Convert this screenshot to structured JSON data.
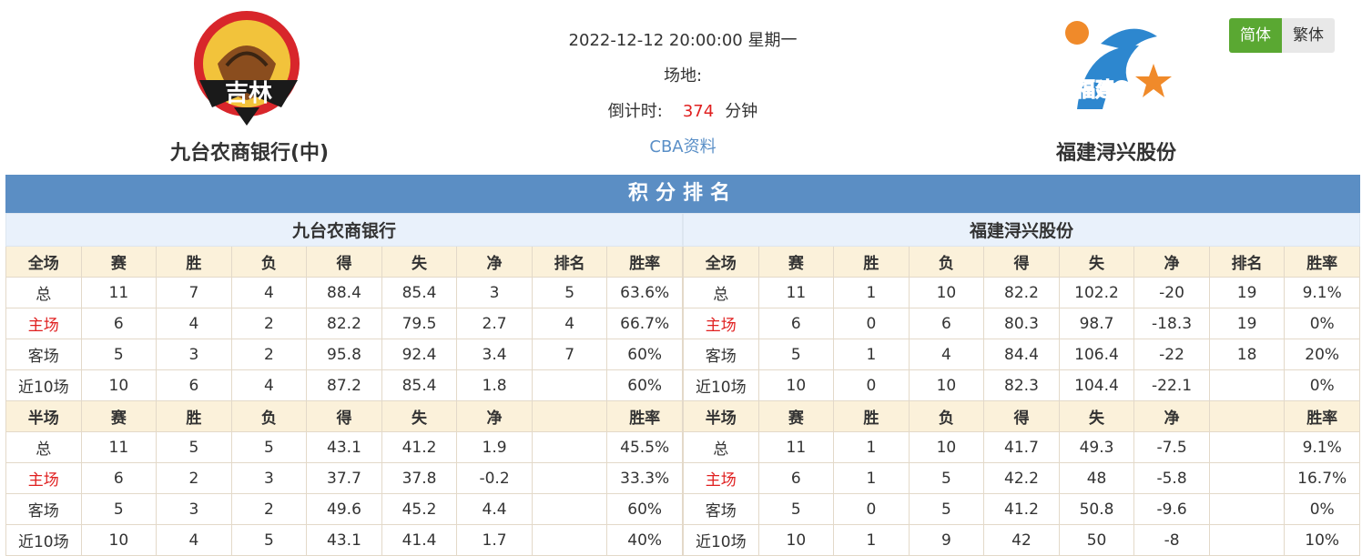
{
  "match": {
    "datetime": "2022-12-12 20:00:00 星期一",
    "venue_label": "场地:",
    "countdown_label": "倒计时:",
    "countdown_value": "374",
    "countdown_unit": "分钟",
    "league_link": "CBA资料"
  },
  "home_team": {
    "name": "九台农商银行(中)",
    "logo_text": "吉林",
    "short_name": "九台农商银行"
  },
  "away_team": {
    "name": "福建浔兴股份",
    "logo_text": "福建",
    "short_name": "福建浔兴股份"
  },
  "lang": {
    "simplified": "简体",
    "traditional": "繁体"
  },
  "colors": {
    "accent_green": "#5aa832",
    "title_blue": "#5b8ec4",
    "red": "#e02020",
    "link": "#5a8fc7"
  },
  "standings": {
    "title": "积分排名",
    "full_headers": [
      "全场",
      "赛",
      "胜",
      "负",
      "得",
      "失",
      "净",
      "排名",
      "胜率"
    ],
    "half_headers": [
      "半场",
      "赛",
      "胜",
      "负",
      "得",
      "失",
      "净",
      "",
      "胜率"
    ],
    "home_full": [
      [
        "总",
        "11",
        "7",
        "4",
        "88.4",
        "85.4",
        "3",
        "5",
        "63.6%"
      ],
      [
        "主场",
        "6",
        "4",
        "2",
        "82.2",
        "79.5",
        "2.7",
        "4",
        "66.7%"
      ],
      [
        "客场",
        "5",
        "3",
        "2",
        "95.8",
        "92.4",
        "3.4",
        "7",
        "60%"
      ],
      [
        "近10场",
        "10",
        "6",
        "4",
        "87.2",
        "85.4",
        "1.8",
        "",
        "60%"
      ]
    ],
    "home_half": [
      [
        "总",
        "11",
        "5",
        "5",
        "43.1",
        "41.2",
        "1.9",
        "",
        "45.5%"
      ],
      [
        "主场",
        "6",
        "2",
        "3",
        "37.7",
        "37.8",
        "-0.2",
        "",
        "33.3%"
      ],
      [
        "客场",
        "5",
        "3",
        "2",
        "49.6",
        "45.2",
        "4.4",
        "",
        "60%"
      ],
      [
        "近10场",
        "10",
        "4",
        "5",
        "43.1",
        "41.4",
        "1.7",
        "",
        "40%"
      ]
    ],
    "away_full": [
      [
        "总",
        "11",
        "1",
        "10",
        "82.2",
        "102.2",
        "-20",
        "19",
        "9.1%"
      ],
      [
        "主场",
        "6",
        "0",
        "6",
        "80.3",
        "98.7",
        "-18.3",
        "19",
        "0%"
      ],
      [
        "客场",
        "5",
        "1",
        "4",
        "84.4",
        "106.4",
        "-22",
        "18",
        "20%"
      ],
      [
        "近10场",
        "10",
        "0",
        "10",
        "82.3",
        "104.4",
        "-22.1",
        "",
        "0%"
      ]
    ],
    "away_half": [
      [
        "总",
        "11",
        "1",
        "10",
        "41.7",
        "49.3",
        "-7.5",
        "",
        "9.1%"
      ],
      [
        "主场",
        "6",
        "1",
        "5",
        "42.2",
        "48",
        "-5.8",
        "",
        "16.7%"
      ],
      [
        "客场",
        "5",
        "0",
        "5",
        "41.2",
        "50.8",
        "-9.6",
        "",
        "0%"
      ],
      [
        "近10场",
        "10",
        "1",
        "9",
        "42",
        "50",
        "-8",
        "",
        "10%"
      ]
    ]
  }
}
